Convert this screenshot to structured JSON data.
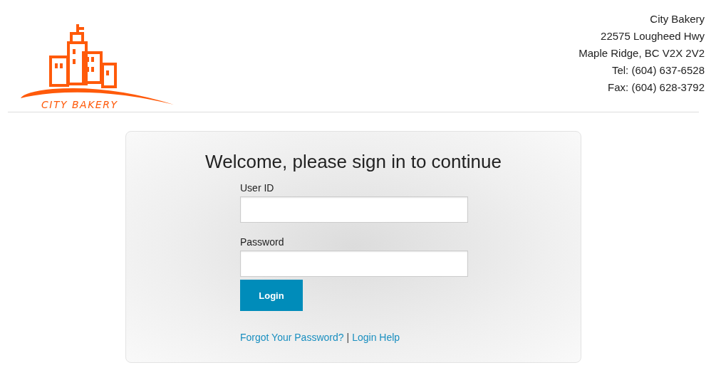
{
  "header": {
    "logo_text": "CITY BAKERY",
    "address": [
      "City Bakery",
      "22575 Lougheed Hwy",
      "Maple Ridge, BC V2X 2V2",
      "Tel: (604) 637-6528",
      "Fax: (604) 628-3792"
    ]
  },
  "login": {
    "title": "Welcome, please sign in to continue",
    "fields": [
      {
        "label": "User ID"
      },
      {
        "label": "Password"
      }
    ],
    "button": "Login",
    "links": [
      "Forgot Your Password?",
      "Login Help"
    ],
    "separator": "|"
  }
}
